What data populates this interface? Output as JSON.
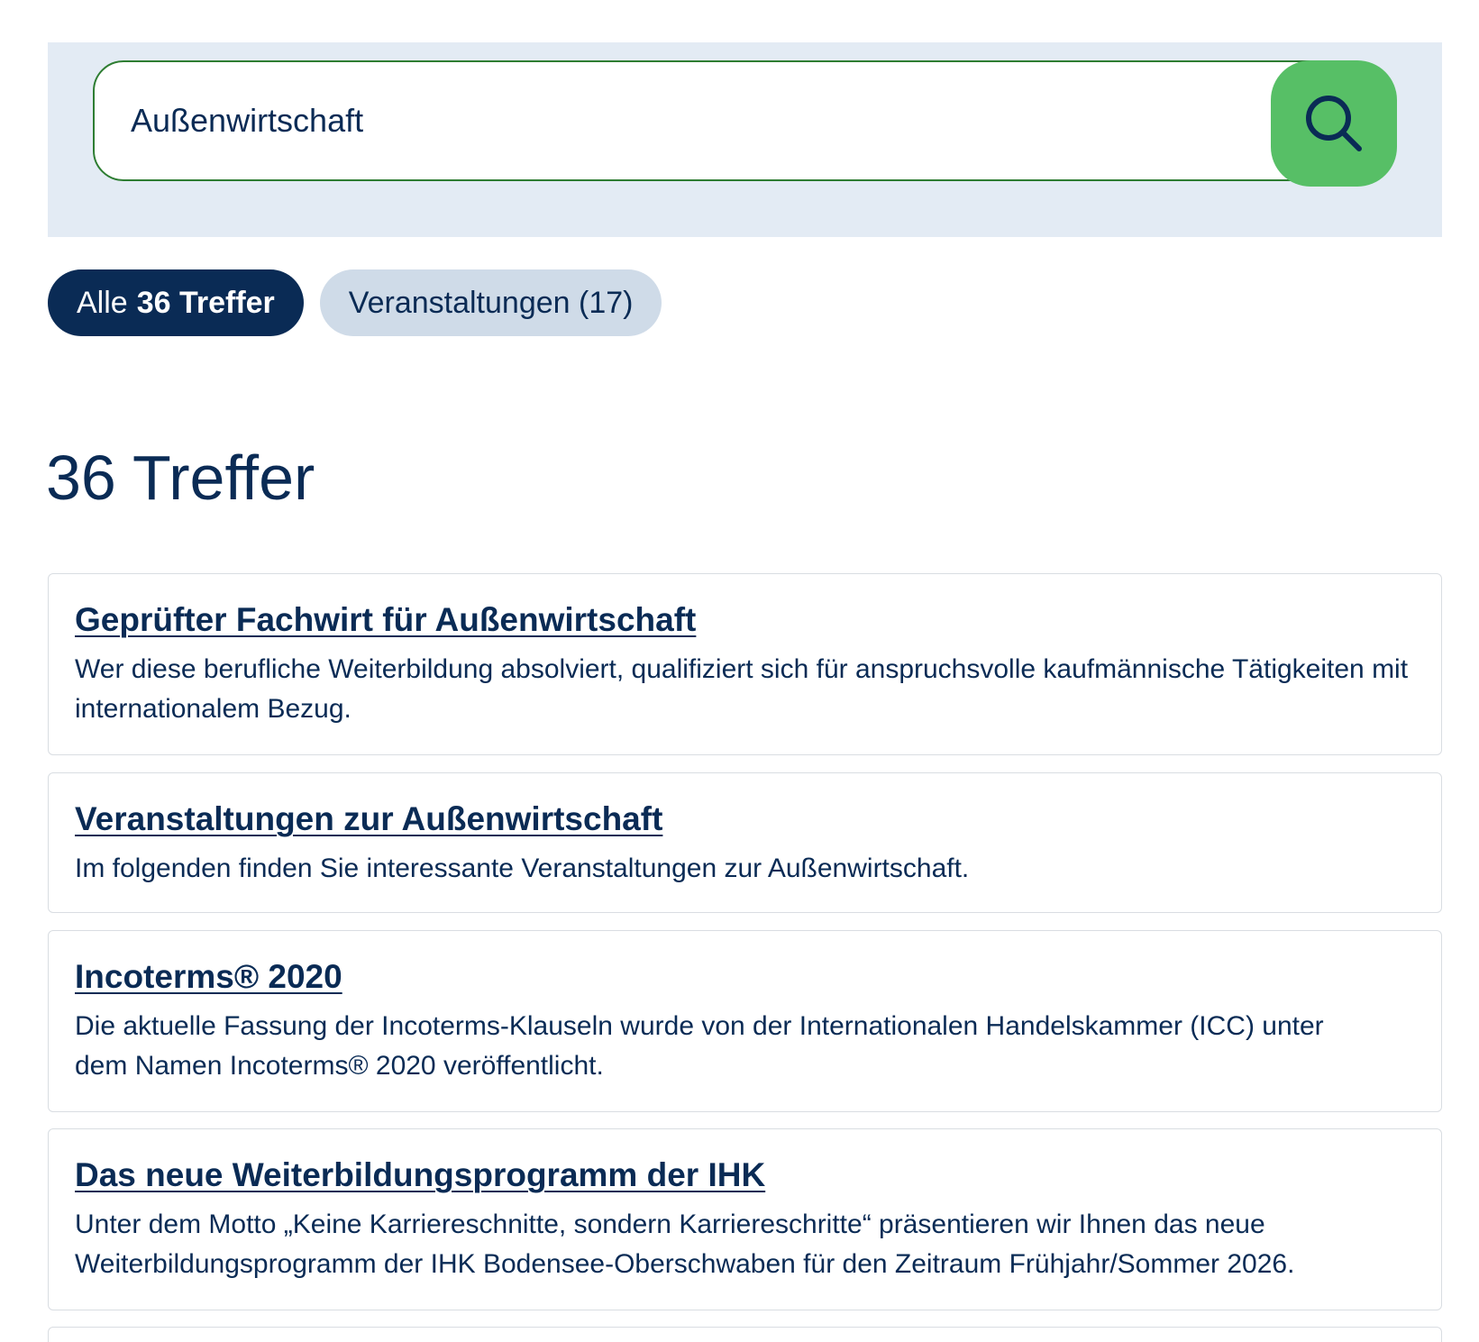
{
  "search": {
    "value": "Außenwirtschaft",
    "button_icon": "search-icon"
  },
  "filters": {
    "all_prefix": "Alle",
    "all_count": "36 Treffer",
    "events_label": "Veranstaltungen (17)"
  },
  "results": {
    "heading": "36 Treffer",
    "items": [
      {
        "title": "Geprüfter Fachwirt für Außenwirtschaft",
        "description": "Wer diese berufliche Weiterbildung absolviert, qualifiziert sich für anspruchsvolle kaufmännische Tätigkeiten mit internationalem Bezug."
      },
      {
        "title": "Veranstaltungen zur Außenwirtschaft",
        "description": "Im folgenden finden Sie interessante Veranstaltungen zur Außenwirtschaft."
      },
      {
        "title": "Incoterms® 2020",
        "description": "Die aktuelle Fassung der Incoterms-Klauseln wurde von der Internationalen Handelskammer (ICC) unter dem Namen Incoterms® 2020 veröffentlicht."
      },
      {
        "title": "Das neue Weiterbildungsprogramm der IHK",
        "description": "Unter dem Motto „Keine Karriereschnitte, sondern Karriereschritte“ präsentieren wir Ihnen das neue Weiterbildungsprogramm der IHK Bodensee-Oberschwaben für den Zeitraum Frühjahr/Sommer 2026."
      }
    ]
  },
  "colors": {
    "primary": "#0a2b55",
    "search_button": "#57bf66",
    "panel_bg": "#e3ebf4",
    "pill_inactive": "#cfdbe8",
    "input_border": "#2e7d32"
  }
}
